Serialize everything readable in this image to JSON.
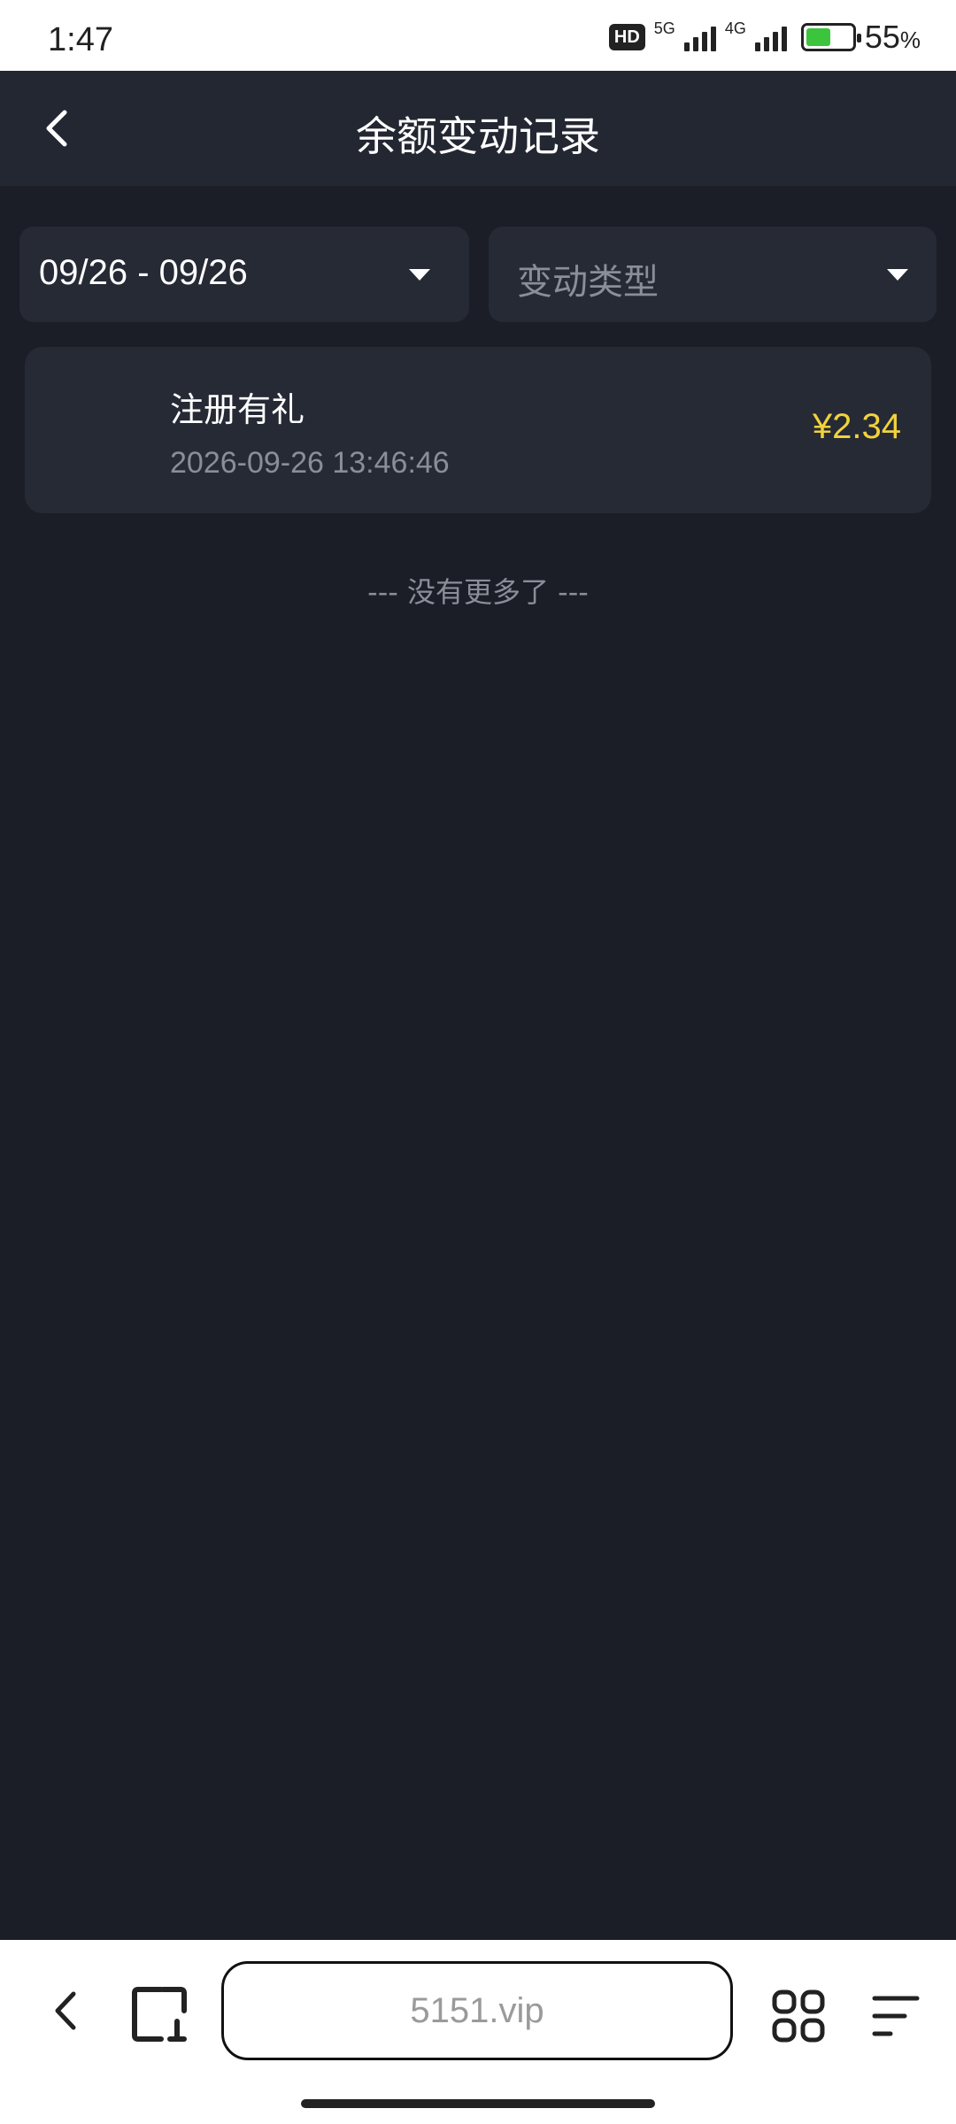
{
  "status_bar": {
    "time": "1:47",
    "hd_badge": "HD",
    "network_1": "5G",
    "network_2": "4G",
    "battery_percent": "55",
    "battery_unit": "%",
    "battery_level": 0.55,
    "icons": [
      "hd-icon",
      "signal-5g-icon",
      "signal-4g-icon",
      "battery-charging-icon"
    ]
  },
  "header": {
    "title": "余额变动记录",
    "back_icon": "chevron-left-icon"
  },
  "filters": {
    "date_range": "09/26 - 09/26",
    "type_placeholder": "变动类型",
    "dropdown_icon": "caret-down-icon"
  },
  "records": [
    {
      "title": "注册有礼",
      "time": "2026-09-26 13:46:46",
      "amount": "¥2.34"
    }
  ],
  "list_end_text": "--- 没有更多了 ---",
  "browser": {
    "url": "5151.vip",
    "icons": [
      "back-icon",
      "tabs-icon",
      "apps-grid-icon",
      "menu-icon"
    ]
  },
  "colors": {
    "background": "#1b1e27",
    "card": "#262a35",
    "header": "#232732",
    "amount": "#f2d23c",
    "muted_text": "#8a8e99",
    "battery_green": "#3cc43c"
  }
}
